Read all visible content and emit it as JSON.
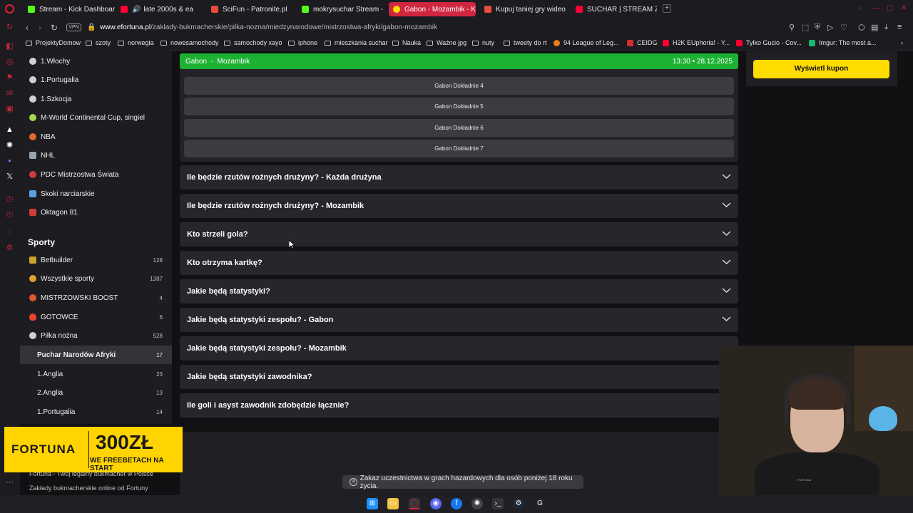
{
  "tabs": [
    {
      "title": "Stream - Kick Dashboard",
      "active": false,
      "icon_color": "#53fc18"
    },
    {
      "title": "late 2000s & ea",
      "active": false,
      "icon_color": "#ff0033"
    },
    {
      "title": "SciFun - Patronite.pl",
      "active": false,
      "icon_color": "#e74c3c"
    },
    {
      "title": "mokrysuchar Stream - W",
      "active": false,
      "icon_color": "#53fc18"
    },
    {
      "title": "Gabon - Mozambik - Kur",
      "active": true,
      "icon_color": "#ffdc00"
    },
    {
      "title": "Kupuj taniej gry wideo na",
      "active": false,
      "icon_color": "#e74c3c"
    },
    {
      "title": "SUCHAR | STREAM Z NO",
      "active": false,
      "icon_color": "#ff0033"
    }
  ],
  "address": {
    "vpn": "VPN",
    "host": "www.efortuna.pl",
    "path": "/zaklady-bukmacherskie/pilka-nozna/miedzynarodowe/mistrzostwa-afryki/gabon-mozambik"
  },
  "bookmarks": [
    {
      "label": "ProjektyDomow",
      "kind": "folder"
    },
    {
      "label": "szoty",
      "kind": "folder"
    },
    {
      "label": "norwegia",
      "kind": "folder"
    },
    {
      "label": "nowesamochody",
      "kind": "folder"
    },
    {
      "label": "samochody xayo",
      "kind": "folder"
    },
    {
      "label": "iphone",
      "kind": "folder"
    },
    {
      "label": "mieszkania suchar",
      "kind": "folder"
    },
    {
      "label": "Nauka",
      "kind": "folder"
    },
    {
      "label": "Ważne jpg",
      "kind": "folder"
    },
    {
      "label": "nuty",
      "kind": "folder"
    },
    {
      "label": "tweety do rt",
      "kind": "folder"
    },
    {
      "label": "94 League of Leg...",
      "kind": "site",
      "color": "#e67e22"
    },
    {
      "label": "CEIDG",
      "kind": "site",
      "color": "#d32f2f"
    },
    {
      "label": "H2K EUphoria! - Y...",
      "kind": "site",
      "color": "#ff0033"
    },
    {
      "label": "Tylko Gucio - Cov...",
      "kind": "site",
      "color": "#ff0033"
    },
    {
      "label": "Imgur: The most a...",
      "kind": "site",
      "color": "#1bb76e"
    }
  ],
  "leftnav": {
    "top_items": [
      {
        "label": "1.Włochy",
        "icon": "soccer-ball-icon",
        "color": "#cfcfcf"
      },
      {
        "label": "1.Portugalia",
        "icon": "soccer-ball-icon",
        "color": "#cfcfcf"
      },
      {
        "label": "1.Szkocja",
        "icon": "soccer-ball-icon",
        "color": "#cfcfcf"
      },
      {
        "label": "M-World Continental Cup, singiel",
        "icon": "tennis-ball-icon",
        "color": "#a5d84a"
      },
      {
        "label": "NBA",
        "icon": "basketball-icon",
        "color": "#e06a2c"
      },
      {
        "label": "NHL",
        "icon": "hockey-icon",
        "color": "#9aa3b0"
      },
      {
        "label": "PDC Mistrzostwa Świata",
        "icon": "darts-icon",
        "color": "#d33b3b"
      },
      {
        "label": "Skoki narciarskie",
        "icon": "ski-jump-icon",
        "color": "#5aa0e0"
      },
      {
        "label": "Oktagon 81",
        "icon": "mma-icon",
        "color": "#d33b3b"
      }
    ],
    "section_title": "Sporty",
    "sport_items": [
      {
        "label": "Betbuilder",
        "count": "128",
        "icon": "betbuilder-icon",
        "color": "#c9a227"
      },
      {
        "label": "Wszystkie sporty",
        "count": "1387",
        "icon": "all-sports-icon",
        "color": "#e0a030"
      },
      {
        "label": "MISTRZOWSKI BOOST",
        "count": "4",
        "icon": "boost-icon",
        "color": "#e05a30"
      },
      {
        "label": "GOTOWCE",
        "count": "6",
        "icon": "fire-icon",
        "color": "#e8452c"
      },
      {
        "label": "Piłka nożna",
        "count": "528",
        "icon": "soccer-ball-icon",
        "color": "#cfcfcf"
      }
    ],
    "sub_items": [
      {
        "label": "Puchar Narodów Afryki",
        "count": "17",
        "selected": true
      },
      {
        "label": "1.Anglia",
        "count": "23",
        "selected": false
      },
      {
        "label": "2.Anglia",
        "count": "13",
        "selected": false
      },
      {
        "label": "1.Portugalia",
        "count": "14",
        "selected": false
      }
    ]
  },
  "match": {
    "home": "Gabon",
    "separator": "-",
    "away": "Mozambik",
    "time": "13:30",
    "dot": "•",
    "date": "28.12.2025"
  },
  "odds": [
    "Gabon Dokładnie 4",
    "Gabon Dokładnie 5",
    "Gabon Dokładnie 6",
    "Gabon Dokładnie 7"
  ],
  "markets": [
    "Ile będzie rzutów rożnych drużyny? - Każda drużyna",
    "Ile będzie rzutów rożnych drużyny? - Mozambik",
    "Kto strzeli gola?",
    "Kto otrzyma kartkę?",
    "Jakie będą statystyki?",
    "Jakie będą statystyki zespołu? - Gabon",
    "Jakie będą statystyki zespołu? - Mozambik",
    "Jakie będą statystyki zawodnika?",
    "Ile goli i asyst zawodnik zdobędzie łącznie?"
  ],
  "coupon": {
    "button": "Wyświetl kupon"
  },
  "banner": {
    "brand": "FORTUNA",
    "amount": "300ZŁ",
    "sub": "WE FREEBETACH NA START"
  },
  "footer": {
    "line1": "Fortuna - Twój legalny bukmacher w Polsce",
    "line2": "Zakłady bukmacherskie online od Fortuny"
  },
  "warning": {
    "badge": "18",
    "text": "Zakaz uczestnictwa w grach hazardowych dla osób poniżej 18 roku życia."
  },
  "webcam": {
    "shirt_text": "FORTUNA"
  },
  "taskbar": [
    {
      "name": "windows-start",
      "color": "#1e90ff"
    },
    {
      "name": "file-explorer",
      "color": "#f4c542"
    },
    {
      "name": "opera-gx",
      "color": "#d0263f"
    },
    {
      "name": "discord",
      "color": "#5865f2"
    },
    {
      "name": "facebook",
      "color": "#1877f2"
    },
    {
      "name": "chatgpt",
      "color": "#444"
    },
    {
      "name": "terminal",
      "color": "#333"
    },
    {
      "name": "steam",
      "color": "#1b2838"
    },
    {
      "name": "g-hub",
      "color": "#222"
    }
  ]
}
